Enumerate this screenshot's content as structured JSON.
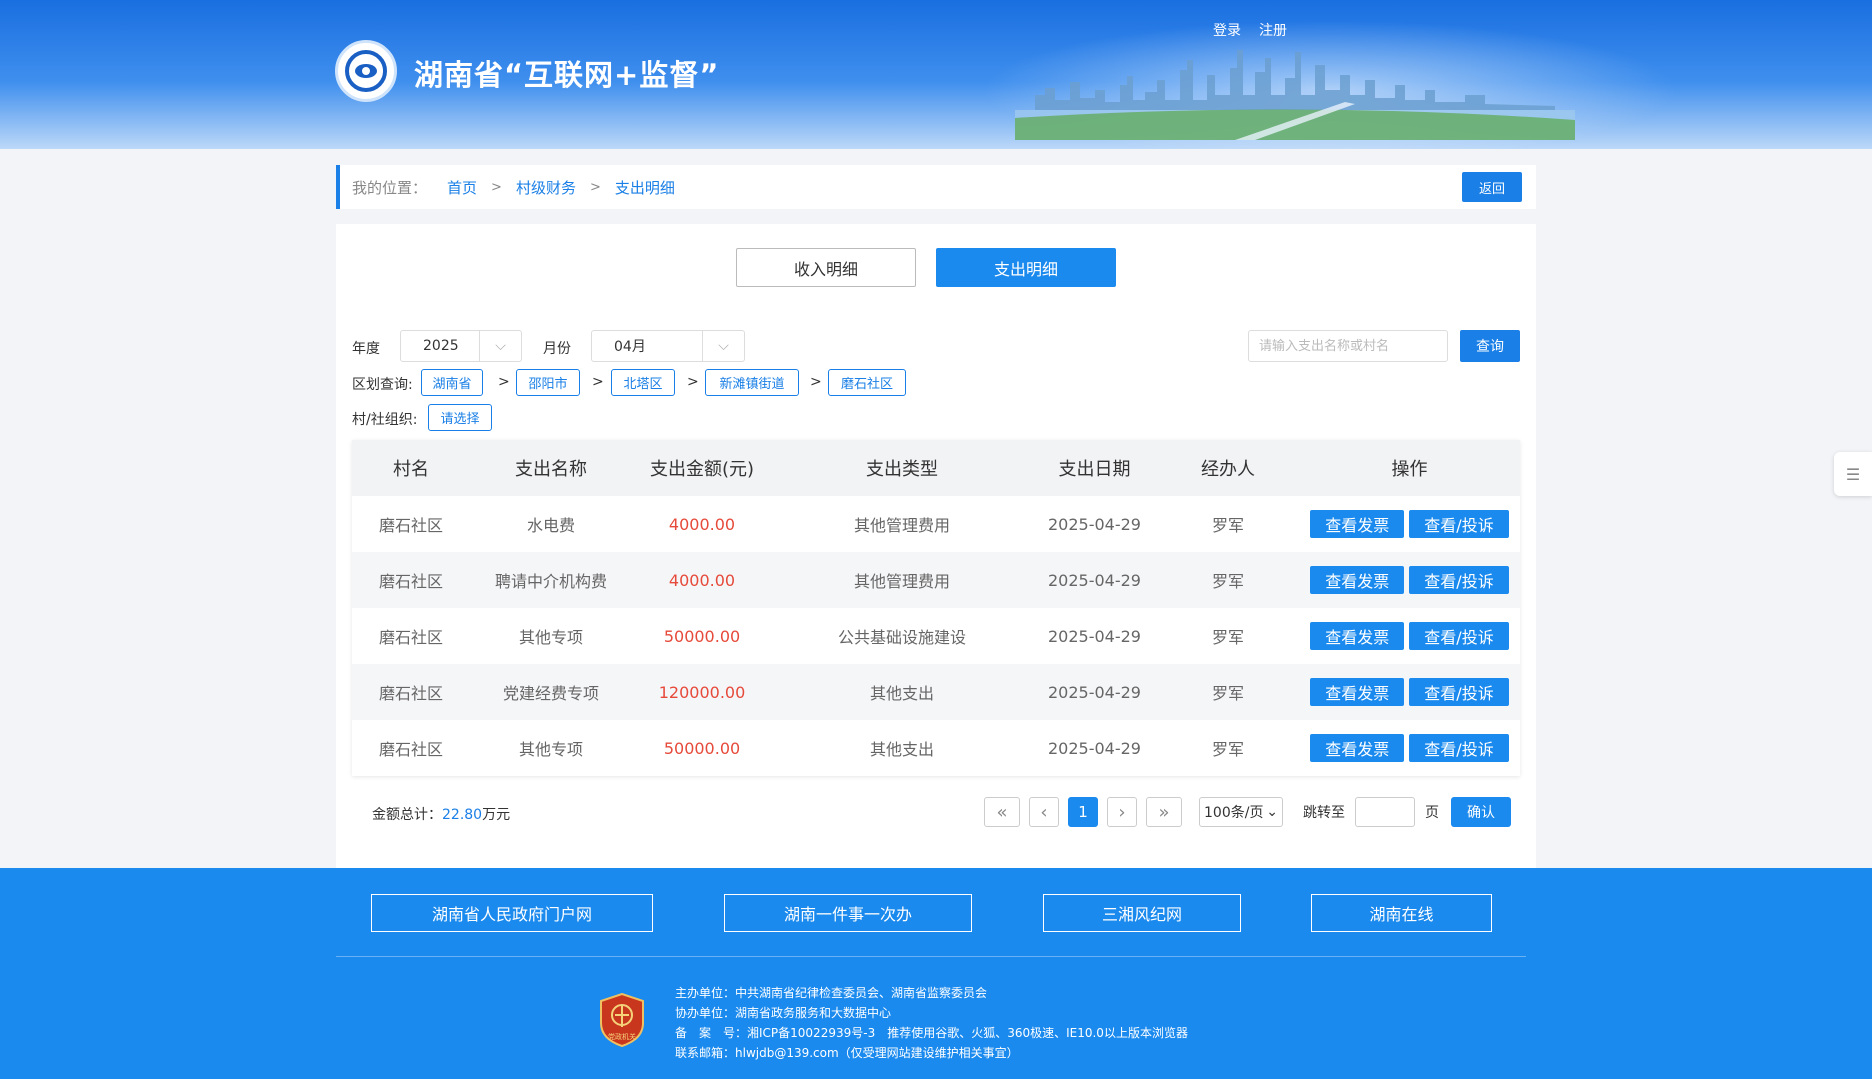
{
  "header": {
    "site_title": "湖南省“互联网+监督”",
    "login": "登录",
    "register": "注册"
  },
  "breadcrumb": {
    "label": "我的位置：",
    "items": [
      "首页",
      "村级财务",
      "支出明细"
    ],
    "separator": ">",
    "back": "返回"
  },
  "tabs": {
    "income": "收入明细",
    "expense": "支出明细"
  },
  "filters": {
    "year_label": "年度",
    "year_value": "2025",
    "month_label": "月份",
    "month_value": "04月",
    "search_placeholder": "请输入支出名称或村名",
    "query": "查询",
    "region_label": "区划查询:",
    "regions": [
      "湖南省",
      "邵阳市",
      "北塔区",
      "新滩镇街道",
      "磨石社区"
    ],
    "org_label": "村/社组织:",
    "org_select": "请选择"
  },
  "table": {
    "headers": [
      "村名",
      "支出名称",
      "支出金额(元)",
      "支出类型",
      "支出日期",
      "经办人",
      "操作"
    ],
    "rows": [
      {
        "village": "磨石社区",
        "name": "水电费",
        "amount": "4000.00",
        "type": "其他管理费用",
        "date": "2025-04-29",
        "handler": "罗军"
      },
      {
        "village": "磨石社区",
        "name": "聘请中介机构费",
        "amount": "4000.00",
        "type": "其他管理费用",
        "date": "2025-04-29",
        "handler": "罗军"
      },
      {
        "village": "磨石社区",
        "name": "其他专项",
        "amount": "50000.00",
        "type": "公共基础设施建设",
        "date": "2025-04-29",
        "handler": "罗军"
      },
      {
        "village": "磨石社区",
        "name": "党建经费专项",
        "amount": "120000.00",
        "type": "其他支出",
        "date": "2025-04-29",
        "handler": "罗军"
      },
      {
        "village": "磨石社区",
        "name": "其他专项",
        "amount": "50000.00",
        "type": "其他支出",
        "date": "2025-04-29",
        "handler": "罗军"
      }
    ],
    "op_invoice": "查看发票",
    "op_complain": "查看/投诉"
  },
  "summary": {
    "label": "金额总计：",
    "value": "22.80",
    "unit": "万元"
  },
  "pagination": {
    "first": "«",
    "prev": "‹",
    "current": "1",
    "next": "›",
    "last": "»",
    "page_size": "100条/页",
    "jump_label": "跳转至",
    "page_unit": "页",
    "confirm": "确认"
  },
  "footer": {
    "links": [
      "湖南省人民政府门户网",
      "湖南一件事一次办",
      "三湘风纪网",
      "湖南在线"
    ],
    "badge_text": "党政机关",
    "info": [
      "主办单位：中共湖南省纪律检查委员会、湖南省监察委员会",
      "协办单位：湖南省政务服务和大数据中心",
      "备　案　号：湘ICP备10022939号-3　推荐使用谷歌、火狐、360极速、IE10.0以上版本浏览器",
      "联系邮箱：hlwjdb@139.com（仅受理网站建设维护相关事宜）"
    ]
  },
  "colors": {
    "primary": "#1a8aee",
    "amount": "#e64a3a"
  }
}
